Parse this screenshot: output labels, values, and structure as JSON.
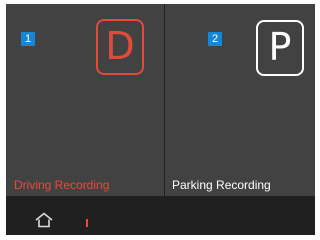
{
  "modes": [
    {
      "number": "1",
      "icon_letter": "D",
      "label": "Driving Recording",
      "color": "#e34a39"
    },
    {
      "number": "2",
      "icon_letter": "P",
      "label": "Parking Recording",
      "color": "#ffffff"
    }
  ],
  "bottom_bar": {
    "home_icon": "home-icon"
  }
}
